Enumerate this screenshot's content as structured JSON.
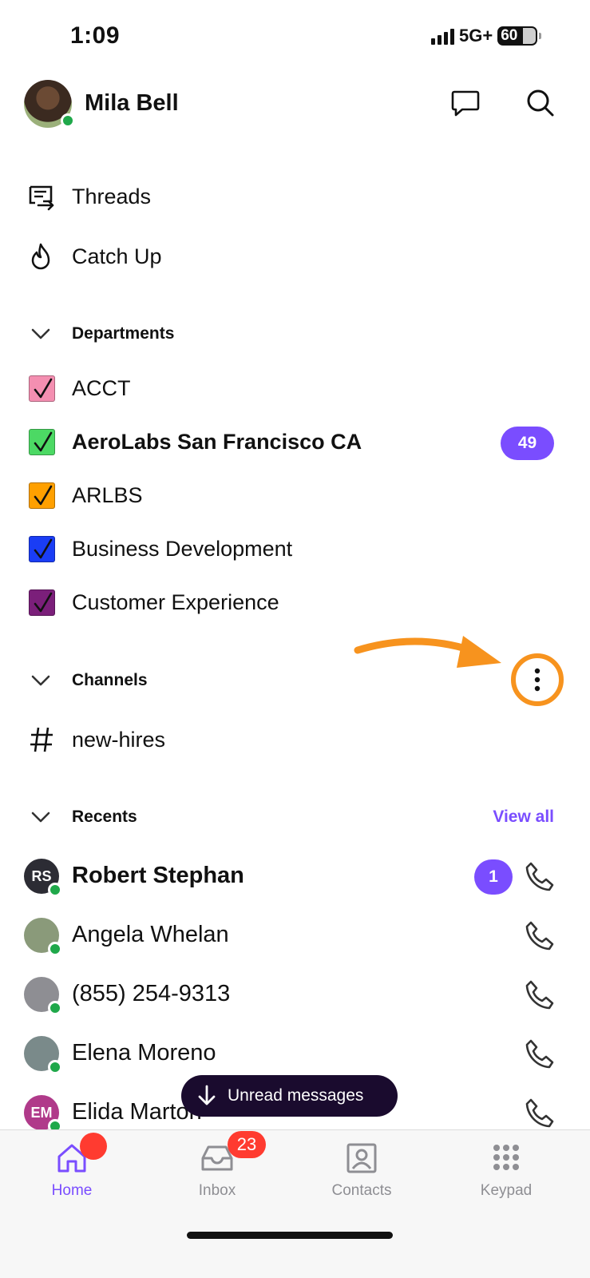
{
  "status_bar": {
    "time": "1:09",
    "network": "5G+",
    "battery": "60"
  },
  "header": {
    "user_name": "Mila Bell",
    "compose_icon": "chat-bubble-icon",
    "search_icon": "search-icon"
  },
  "nav": {
    "threads": {
      "label": "Threads",
      "icon": "threads-icon"
    },
    "catch_up": {
      "label": "Catch Up",
      "icon": "flame-icon"
    }
  },
  "departments": {
    "title": "Departments",
    "items": [
      {
        "label": "ACCT",
        "color": "#f48fb1",
        "bold": false,
        "badge": null
      },
      {
        "label": "AeroLabs San Francisco CA",
        "color": "#4cd964",
        "bold": true,
        "badge": "49"
      },
      {
        "label": "ARLBS",
        "color": "#ffa000",
        "bold": false,
        "badge": null
      },
      {
        "label": "Business Development",
        "color": "#1a3df5",
        "bold": false,
        "badge": null
      },
      {
        "label": "Customer Experience",
        "color": "#7b1f7a",
        "bold": false,
        "badge": null
      }
    ]
  },
  "channels": {
    "title": "Channels",
    "more_icon": "more-vertical-icon",
    "items": [
      {
        "label": "new-hires",
        "icon": "hash-icon"
      }
    ]
  },
  "recents": {
    "title": "Recents",
    "view_all": "View all",
    "items": [
      {
        "name": "Robert Stephan",
        "initials": "RS",
        "bold": true,
        "badge": "1",
        "avatar_color": "#2c2c34"
      },
      {
        "name": "Angela Whelan",
        "initials": "",
        "bold": false,
        "badge": null,
        "avatar_color": "#8a9a7a"
      },
      {
        "name": "(855) 254-9313",
        "initials": "",
        "bold": false,
        "badge": null,
        "avatar_color": "#8e8e93"
      },
      {
        "name": "Elena Moreno",
        "initials": "",
        "bold": false,
        "badge": null,
        "avatar_color": "#7a8a8a"
      },
      {
        "name": "Elida Marton",
        "initials": "EM",
        "bold": false,
        "badge": null,
        "avatar_color": "#b03a8a"
      }
    ]
  },
  "toast": {
    "label": "Unread messages"
  },
  "tabs": [
    {
      "label": "Home",
      "icon": "home-icon",
      "active": true,
      "badge": ""
    },
    {
      "label": "Inbox",
      "icon": "inbox-icon",
      "active": false,
      "badge": "23"
    },
    {
      "label": "Contacts",
      "icon": "contacts-icon",
      "active": false,
      "badge": ""
    },
    {
      "label": "Keypad",
      "icon": "keypad-icon",
      "active": false,
      "badge": ""
    }
  ],
  "colors": {
    "accent": "#7a4dff",
    "annotation": "#f7931e",
    "online": "#1fa84a",
    "notification": "#ff3b30"
  }
}
